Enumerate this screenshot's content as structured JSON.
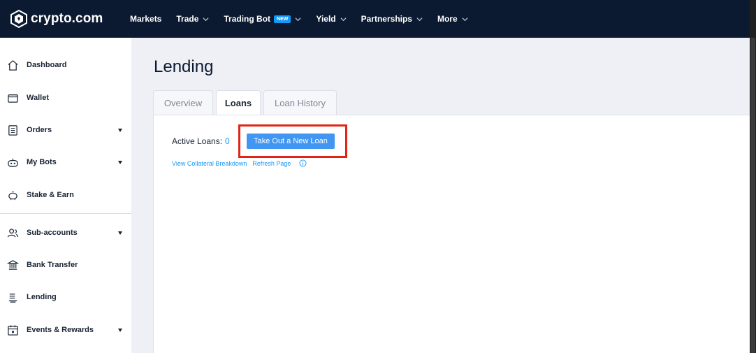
{
  "brand": {
    "name": "crypto.com"
  },
  "topnav": [
    {
      "label": "Markets",
      "has_menu": false,
      "badge": ""
    },
    {
      "label": "Trade",
      "has_menu": true,
      "badge": ""
    },
    {
      "label": "Trading Bot",
      "has_menu": true,
      "badge": "NEW"
    },
    {
      "label": "Yield",
      "has_menu": true,
      "badge": ""
    },
    {
      "label": "Partnerships",
      "has_menu": true,
      "badge": ""
    },
    {
      "label": "More",
      "has_menu": true,
      "badge": ""
    }
  ],
  "sidebar": {
    "items": [
      {
        "label": "Dashboard",
        "icon": "home-icon",
        "expandable": false
      },
      {
        "label": "Wallet",
        "icon": "wallet-icon",
        "expandable": false
      },
      {
        "label": "Orders",
        "icon": "orders-icon",
        "expandable": true
      },
      {
        "label": "My Bots",
        "icon": "bot-icon",
        "expandable": true
      },
      {
        "label": "Stake & Earn",
        "icon": "piggy-bank-icon",
        "expandable": false
      },
      {
        "label": "Sub-accounts",
        "icon": "users-icon",
        "expandable": true
      },
      {
        "label": "Bank Transfer",
        "icon": "bank-icon",
        "expandable": false
      },
      {
        "label": "Lending",
        "icon": "lending-icon",
        "expandable": false
      },
      {
        "label": "Events & Rewards",
        "icon": "calendar-icon",
        "expandable": true
      }
    ]
  },
  "main": {
    "title": "Lending",
    "tabs": [
      {
        "label": "Overview",
        "active": false
      },
      {
        "label": "Loans",
        "active": true
      },
      {
        "label": "Loan History",
        "active": false
      }
    ],
    "active_loans_label": "Active Loans:",
    "active_loans_count": "0",
    "new_loan_button": "Take Out a New Loan",
    "link_collateral": "View Collateral Breakdown",
    "link_refresh": "Refresh Page"
  },
  "colors": {
    "nav_bg": "#0c1a31",
    "accent": "#1199fa",
    "button": "#4196f2",
    "highlight": "#e02516",
    "main_bg": "#eef0f6"
  }
}
